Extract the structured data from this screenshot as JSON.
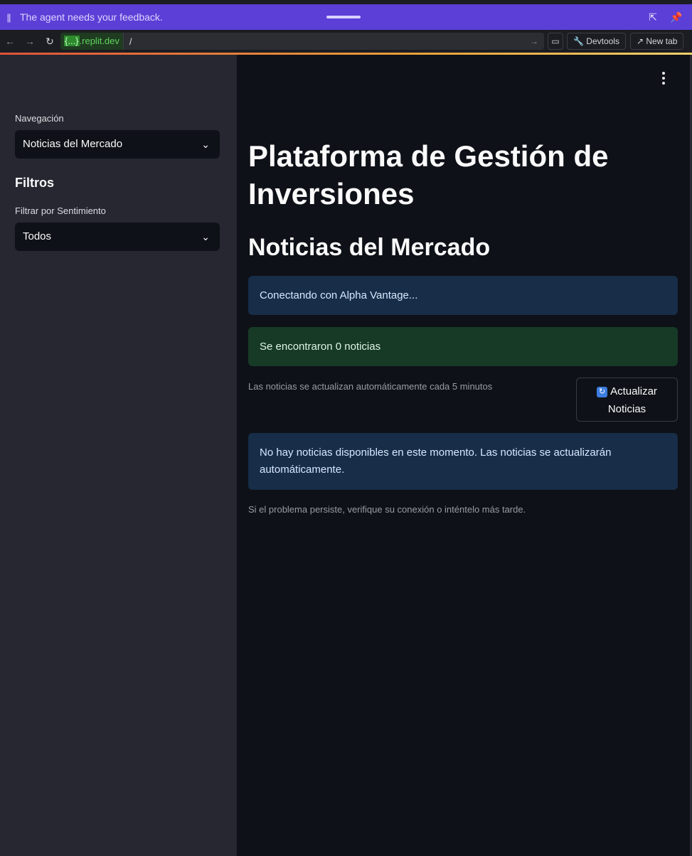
{
  "agent_bar": {
    "message": "The agent needs your feedback.",
    "pause_icon": "pause-icon",
    "popout_icon": "popout-icon",
    "pin_icon": "pin-icon"
  },
  "browser": {
    "domain_highlight": "{...}",
    "domain_suffix": ".replit.dev",
    "path": "/",
    "devtools_label": "Devtools",
    "newtab_label": "New tab"
  },
  "sidebar": {
    "nav_label": "Navegación",
    "nav_value": "Noticias del Mercado",
    "filters_heading": "Filtros",
    "sentiment_label": "Filtrar por Sentimiento",
    "sentiment_value": "Todos"
  },
  "main": {
    "title": "Plataforma de Gestión de Inversiones",
    "subtitle": "Noticias del Mercado",
    "connecting_info": "Conectando con Alpha Vantage...",
    "found_success": "Se encontraron 0 noticias",
    "auto_update_caption": "Las noticias se actualizan automáticamente cada 5 minutos",
    "refresh_button": "Actualizar Noticias",
    "no_news_info": "No hay noticias disponibles en este momento. Las noticias se actualizarán automáticamente.",
    "problem_caption": "Si el problema persiste, verifique su conexión o inténtelo más tarde."
  },
  "colors": {
    "agent_bar": "#5b3fd6",
    "sidebar": "#262730",
    "main_bg": "#0e1117",
    "info_bg": "#172d48",
    "success_bg": "#173a27"
  }
}
